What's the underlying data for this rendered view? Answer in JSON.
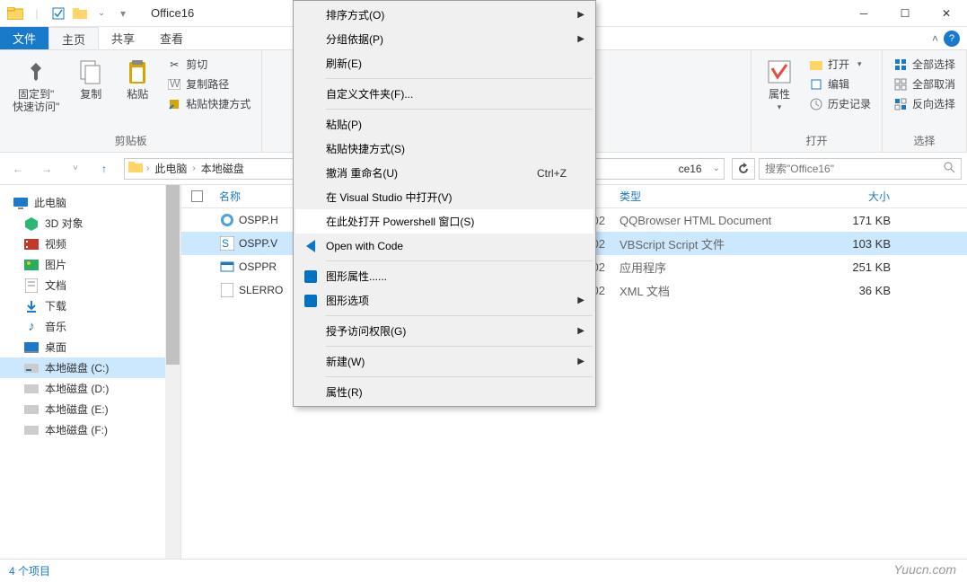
{
  "window": {
    "title": "Office16"
  },
  "tabs": {
    "file": "文件",
    "home": "主页",
    "share": "共享",
    "view": "查看"
  },
  "ribbon": {
    "clipboard": {
      "label": "剪贴板",
      "pin": "固定到\"\n快速访问\"",
      "copy": "复制",
      "paste": "粘贴",
      "cut": "剪切",
      "copypath": "复制路径",
      "pasteshortcut": "粘贴快捷方式"
    },
    "open": {
      "label": "打开",
      "properties": "属性",
      "open": "打开",
      "edit": "编辑",
      "history": "历史记录"
    },
    "select": {
      "label": "选择",
      "selectall": "全部选择",
      "selectnone": "全部取消",
      "invert": "反向选择"
    }
  },
  "breadcrumb": {
    "thispc": "此电脑",
    "drive": "本地磁盘",
    "end": "ce16"
  },
  "search": {
    "placeholder": "搜索\"Office16\""
  },
  "tree": {
    "thispc": "此电脑",
    "objects3d": "3D 对象",
    "videos": "视频",
    "pictures": "图片",
    "documents": "文档",
    "downloads": "下载",
    "music": "音乐",
    "desktop": "桌面",
    "drivec": "本地磁盘 (C:)",
    "drived": "本地磁盘 (D:)",
    "drivee": "本地磁盘 (E:)",
    "drivef": "本地磁盘 (F:)"
  },
  "columns": {
    "name": "名称",
    "type": "类型",
    "size": "大小"
  },
  "files": [
    {
      "name": "OSPP.H",
      "date": "02",
      "type": "QQBrowser HTML Document",
      "size": "171 KB"
    },
    {
      "name": "OSPP.V",
      "date": "02",
      "type": "VBScript Script 文件",
      "size": "103 KB"
    },
    {
      "name": "OSPPR",
      "date": "02",
      "type": "应用程序",
      "size": "251 KB"
    },
    {
      "name": "SLERRO",
      "date": "02",
      "type": "XML 文档",
      "size": "36 KB"
    }
  ],
  "status": {
    "count": "4 个项目"
  },
  "watermark": "Yuucn.com",
  "contextmenu": {
    "sort": "排序方式(O)",
    "groupby": "分组依据(P)",
    "refresh": "刷新(E)",
    "customize": "自定义文件夹(F)...",
    "paste": "粘贴(P)",
    "pasteshortcut": "粘贴快捷方式(S)",
    "undo": "撤消 重命名(U)",
    "undo_shortcut": "Ctrl+Z",
    "openvs": "在 Visual Studio 中打开(V)",
    "openps": "在此处打开 Powershell 窗口(S)",
    "opencode": "Open with Code",
    "graphicsprops": "图形属性......",
    "graphicsopts": "图形选项",
    "grantaccess": "授予访问权限(G)",
    "new": "新建(W)",
    "properties": "属性(R)"
  }
}
